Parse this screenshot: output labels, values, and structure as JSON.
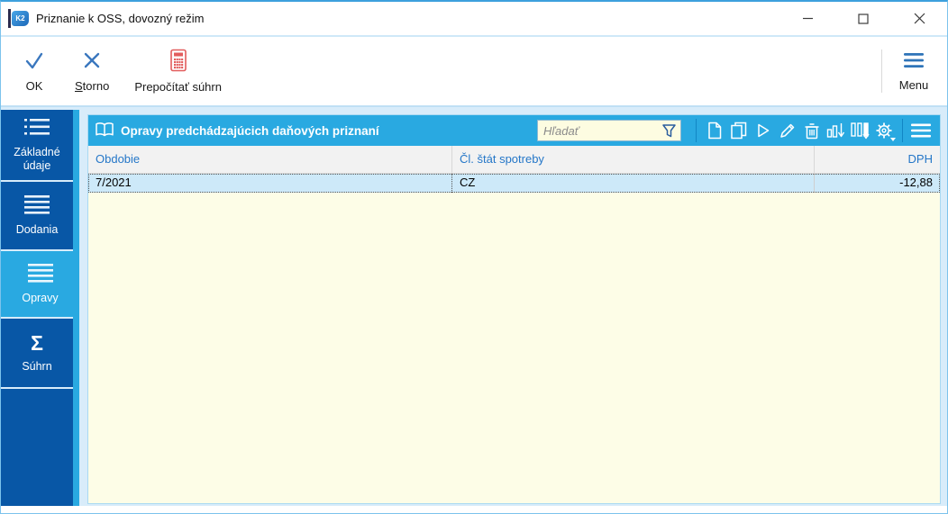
{
  "window": {
    "title": "Priznanie k OSS, dovozný režim",
    "app_badge": "K2"
  },
  "toolbar": {
    "ok_label": "OK",
    "storno_accel": "S",
    "storno_rest": "torno",
    "recalc_label": "Prepočítať súhrn",
    "menu_label": "Menu"
  },
  "sidebar": {
    "items": [
      {
        "label": "Základné údaje",
        "icon": "detail-list",
        "selected": false
      },
      {
        "label": "Dodania",
        "icon": "lines",
        "selected": false
      },
      {
        "label": "Opravy",
        "icon": "lines",
        "selected": true
      },
      {
        "label": "Súhrn",
        "icon": "sigma",
        "selected": false
      }
    ],
    "sigma_glyph": "Σ"
  },
  "panel": {
    "title": "Opravy predchádzajúcich daňových priznaní",
    "search_placeholder": "Hľadať",
    "header_icons": [
      "book-icon",
      "filter-funnel-icon",
      "new-record-icon",
      "copy-record-icon",
      "run-icon",
      "edit-icon",
      "delete-icon",
      "chart-export-icon",
      "columns-export-icon",
      "settings-gear-icon",
      "grid-menu-icon"
    ]
  },
  "table": {
    "columns": [
      "Obdobie",
      "Čl. štát spotreby",
      "DPH"
    ],
    "rows": [
      [
        "7/2021",
        "CZ",
        "-12,88"
      ]
    ]
  },
  "colors": {
    "sidebar_dark": "#0857a6",
    "accent_blue": "#29a9e1",
    "toolbar_icon_blue": "#3a77be",
    "calculator_red": "#e25d5d",
    "table_body_yellow": "#fdfde7",
    "selected_row_blue": "#cde9f9",
    "header_text_blue": "#2577c8",
    "content_bg": "#d8ecfa"
  }
}
